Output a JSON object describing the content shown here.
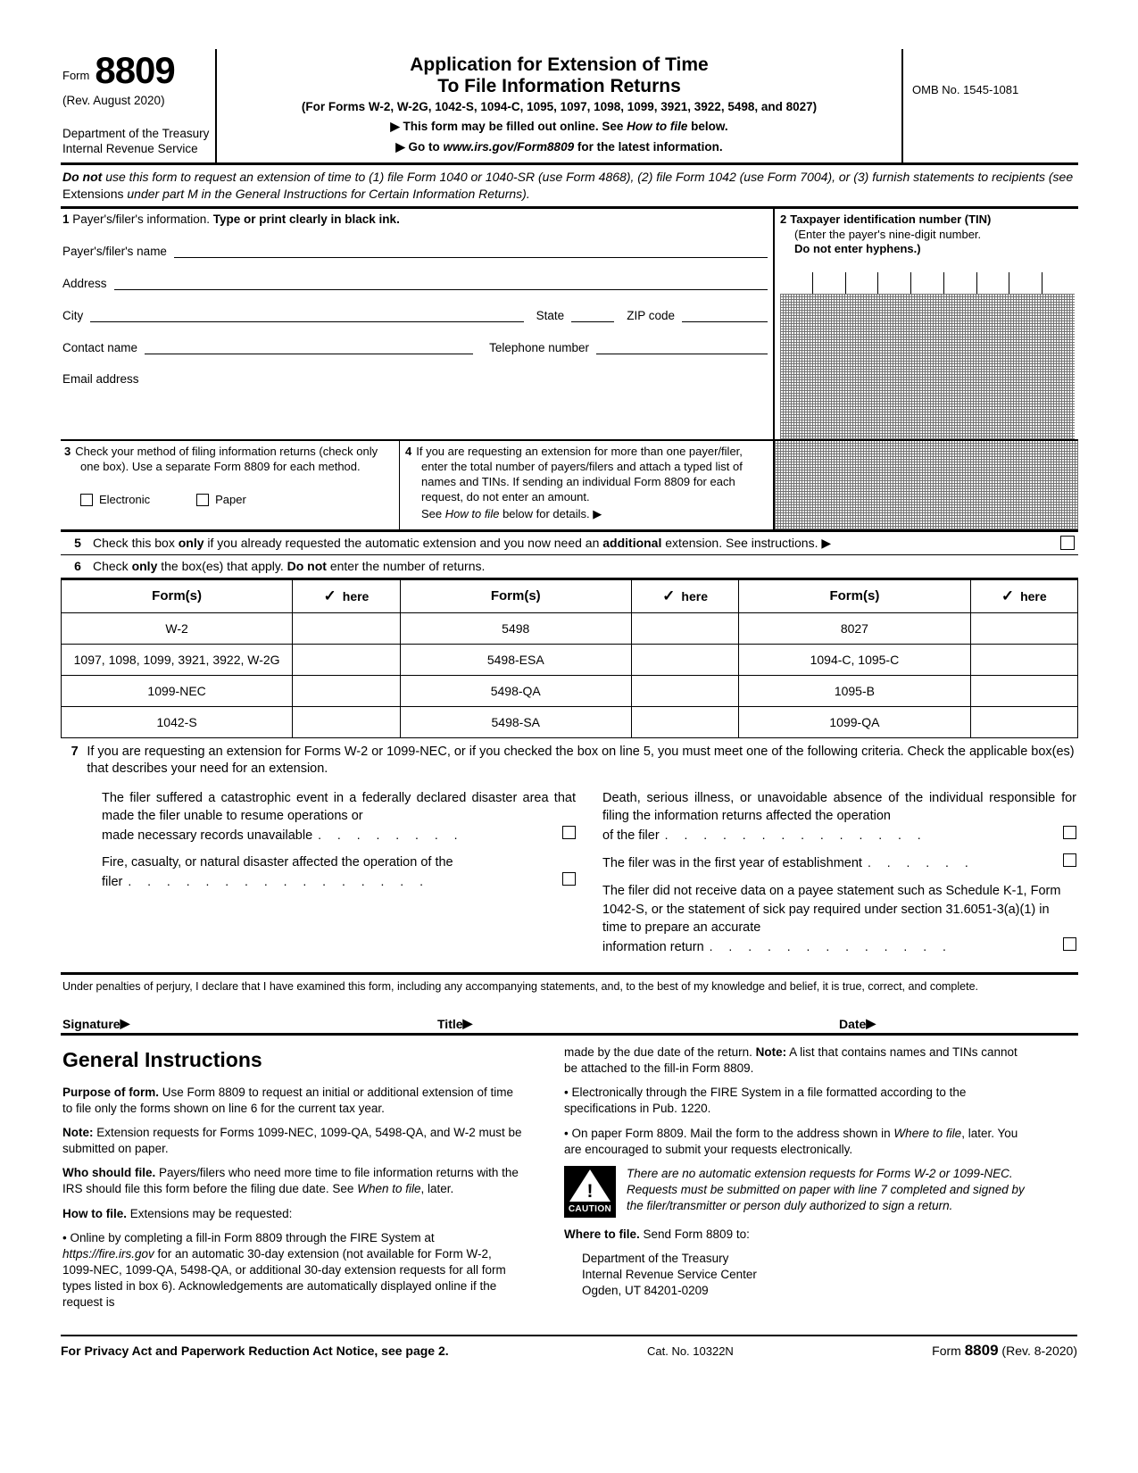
{
  "header": {
    "form_word": "Form",
    "form_number": "8809",
    "revision": "(Rev. August 2020)",
    "dept_line1": "Department of the Treasury",
    "dept_line2": "Internal Revenue Service",
    "title_line1": "Application for Extension of Time",
    "title_line2": "To File Information Returns",
    "subtitle": "(For Forms W-2, W-2G, 1042-S, 1094-C, 1095, 1097, 1098, 1099, 3921, 3922, 5498, and 8027)",
    "arrow1_a": "This form may be filled out online. See ",
    "arrow1_b": "How to file",
    "arrow1_c": " below.",
    "arrow2_a": "Go to ",
    "arrow2_b": "www.irs.gov/Form8809",
    "arrow2_c": " for the latest information.",
    "omb": "OMB No. 1545-1081"
  },
  "donot": {
    "bold": "Do not",
    "text1": " use this form to request an extension of time to (1) file Form 1040 or 1040-SR (use Form 4868), (2) file Form 1042 (use Form 7004), or (3) furnish statements to recipients (see ",
    "roman1": "Extensions",
    "text2": " under part M in the ",
    "ital2": "General Instructions for Certain Information Returns",
    "text3": ")."
  },
  "line1": {
    "num": "1",
    "head_plain": "Payer's/filer's information. ",
    "head_bold": "Type or print clearly in black ink.",
    "label_name": "Payer's/filer's name",
    "label_address": "Address",
    "label_city": "City",
    "label_state": "State",
    "label_zip": "ZIP code",
    "label_contact": "Contact name",
    "label_phone": "Telephone number",
    "label_email": "Email address"
  },
  "line2": {
    "num": "2",
    "title": "Taxpayer identification number (TIN)",
    "sub1": "(Enter the payer's nine-digit number.",
    "sub2": "Do not enter hyphens.)",
    "cells": 9
  },
  "line3": {
    "num": "3",
    "text": "Check your method of filing information returns (check only one box). Use a separate Form 8809 for each method.",
    "option_electronic": "Electronic",
    "option_paper": "Paper"
  },
  "line4": {
    "num": "4",
    "text_a": "If you are requesting an extension for more than one payer/filer, enter the total number of payers/filers and attach a typed list of names and TINs. If sending an individual Form 8809 for each request, do not enter an amount.",
    "see_plain": "See ",
    "see_ital": "How to file",
    "see_rest": " below for details. "
  },
  "line5": {
    "num": "5",
    "t1": "Check this box ",
    "b1": "only",
    "t2": " if you already requested the automatic extension and you now need an ",
    "b2": "additional",
    "t3": " extension. See instructions. "
  },
  "line6": {
    "num": "6",
    "t1": "Check ",
    "b1": "only",
    "t2": " the box(es) that apply. ",
    "b2": "Do not",
    "t3": " enter the number of returns."
  },
  "forms_table": {
    "header_form": "Form(s)",
    "header_check": "here",
    "check_glyph": "✓",
    "rows": [
      [
        "W-2",
        "5498",
        "8027"
      ],
      [
        "1097, 1098, 1099, 3921, 3922, W-2G",
        "5498-ESA",
        "1094-C, 1095-C"
      ],
      [
        "1099-NEC",
        "5498-QA",
        "1095-B"
      ],
      [
        "1042-S",
        "5498-SA",
        "1099-QA"
      ]
    ]
  },
  "line7": {
    "num": "7",
    "head": "If you are requesting an extension for Forms W-2 or 1099-NEC, or if you checked the box on line 5, you must meet one of the following criteria. Check the applicable box(es) that describes your need for an extension.",
    "left_items": [
      {
        "body": "The filer suffered a catastrophic event in a federally declared disaster area that made the filer unable to resume operations or",
        "tail": "made necessary records unavailable"
      },
      {
        "body": "Fire, casualty, or natural disaster affected the operation of the",
        "tail": "filer"
      }
    ],
    "right_items": [
      {
        "body": "Death, serious illness, or unavoidable absence of the individual responsible for filing the information returns affected the operation",
        "tail": "of the filer"
      },
      {
        "body": "",
        "tail": "The filer was in the first year of establishment"
      },
      {
        "body": "The filer did not receive data on a payee statement such as Schedule K-1, Form 1042-S, or the statement of sick pay required under section 31.6051-3(a)(1) in time to prepare an accurate",
        "tail": "information return"
      }
    ]
  },
  "perjury": "Under penalties of perjury, I declare that I have examined this form, including any accompanying statements, and, to the best of my knowledge and belief, it is true, correct, and complete.",
  "signature": {
    "label_signature": "Signature ",
    "label_title": "Title ",
    "label_date": "Date ",
    "arrow": "▶"
  },
  "instructions": {
    "title": "General Instructions",
    "left": {
      "purpose_b": "Purpose of form.",
      "purpose_t": " Use Form 8809 to request an initial or additional extension of time to file only the forms shown on line 6 for the current tax year.",
      "note_b": "Note:",
      "note_t": " Extension requests for Forms 1099-NEC, 1099-QA, 5498-QA, and W-2 must be submitted on paper.",
      "who_b": "Who should file.",
      "who_t1": " Payers/filers who need more time to file information returns with the IRS should file this form before the filing due date. See ",
      "who_i": "When to file",
      "who_t2": ", later.",
      "how_b": "How to file.",
      "how_t": " Extensions may be requested:",
      "bullet1_a": "• Online by completing a fill-in Form 8809 through the FIRE System at ",
      "bullet1_i": "https://fire.irs.gov",
      "bullet1_b": " for an automatic 30-day extension (not available for Form W-2, 1099-NEC, 1099-QA, 5498-QA, or additional 30-day extension requests for all form types listed in box 6). Acknowledgements are automatically displayed online if the request is"
    },
    "right": {
      "cont_a": "made by the due date of the return. ",
      "cont_b": "Note:",
      "cont_c": " A list that contains names and TINs cannot be attached to the fill-in Form 8809.",
      "bullet2": "• Electronically through the FIRE System in a file formatted according to the specifications in Pub. 1220.",
      "bullet3_a": "• On paper Form 8809. Mail the form to the address shown in ",
      "bullet3_i": "Where to file",
      "bullet3_b": ", later. You are encouraged to submit your requests electronically.",
      "caution_word": "CAUTION",
      "caution_glyph": "!",
      "caution_text": "There are no automatic extension requests for Forms W-2 or 1099-NEC. Requests must be submitted on paper with line 7 completed and signed by the filer/transmitter or person duly authorized to sign a return.",
      "where_b": "Where to file.",
      "where_t": " Send Form 8809 to:",
      "addr1": "Department of the Treasury",
      "addr2": "Internal Revenue Service Center",
      "addr3": "Ogden, UT 84201-0209"
    }
  },
  "footer": {
    "privacy": "For Privacy Act and Paperwork Reduction Act Notice, see page 2.",
    "cat": "Cat. No. 10322N",
    "form_word": "Form ",
    "form_number": "8809",
    "rev": " (Rev. 8-2020)"
  }
}
